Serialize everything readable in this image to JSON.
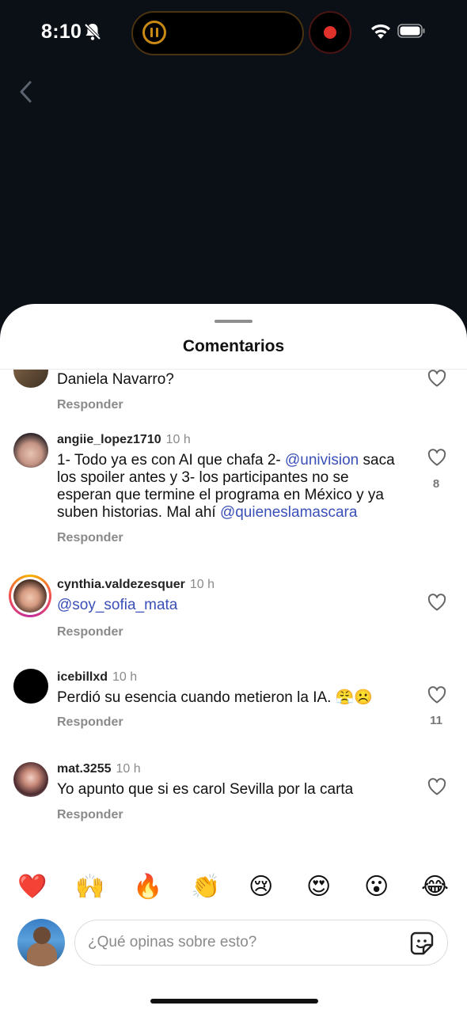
{
  "status_bar": {
    "time": "8:10"
  },
  "sheet": {
    "title": "Comentarios"
  },
  "comments": [
    {
      "username": "",
      "ago": "",
      "text": "Daniela Navarro?",
      "reply": "Responder",
      "likes": ""
    },
    {
      "username": "angiie_lopez1710",
      "ago": "10 h",
      "text_before": "1- Todo ya es con AI que chafa 2- ",
      "mention1": "@univision",
      "text_middle": " saca los spoiler antes y 3- los participantes no se esperan que termine el programa en México y ya suben historias. Mal ahí ",
      "mention2": "@quieneslamascara",
      "reply": "Responder",
      "likes": "8"
    },
    {
      "username": "cynthia.valdezesquer",
      "ago": "10 h",
      "mention": "@soy_sofia_mata",
      "reply": "Responder",
      "likes": ""
    },
    {
      "username": "icebillxd",
      "ago": "10 h",
      "text": "Perdió su esencia cuando metieron la IA. 😤☹️",
      "reply": "Responder",
      "likes": "11"
    },
    {
      "username": "mat.3255",
      "ago": "10 h",
      "text": "Yo apunto que si es carol Sevilla por la carta",
      "reply": "Responder",
      "likes": ""
    }
  ],
  "reactions": [
    "❤️",
    "🙌",
    "🔥",
    "👏",
    "😢",
    "😍",
    "😮",
    "😂"
  ],
  "composer": {
    "placeholder": "¿Qué opinas sobre esto?"
  },
  "icons": [
    "bell-slash-icon",
    "pause-icon",
    "record-icon",
    "wifi-icon",
    "battery-icon",
    "chevron-left-icon",
    "heart-icon",
    "sticker-icon"
  ]
}
